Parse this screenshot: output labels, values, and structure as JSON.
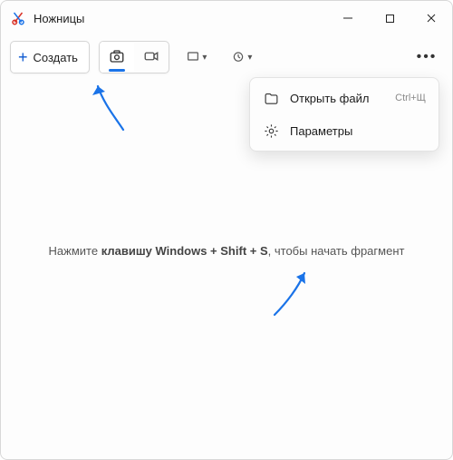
{
  "title": "Ножницы",
  "toolbar": {
    "new_label": "Создать"
  },
  "menu": {
    "open_file": {
      "label": "Открыть файл",
      "shortcut": "Ctrl+Щ"
    },
    "settings": {
      "label": "Параметры"
    }
  },
  "hint": {
    "prefix": "Нажмите ",
    "bold": "клавишу Windows + Shift + S",
    "suffix": ", чтобы начать фрагмент"
  },
  "colors": {
    "accent": "#1a73e8"
  }
}
